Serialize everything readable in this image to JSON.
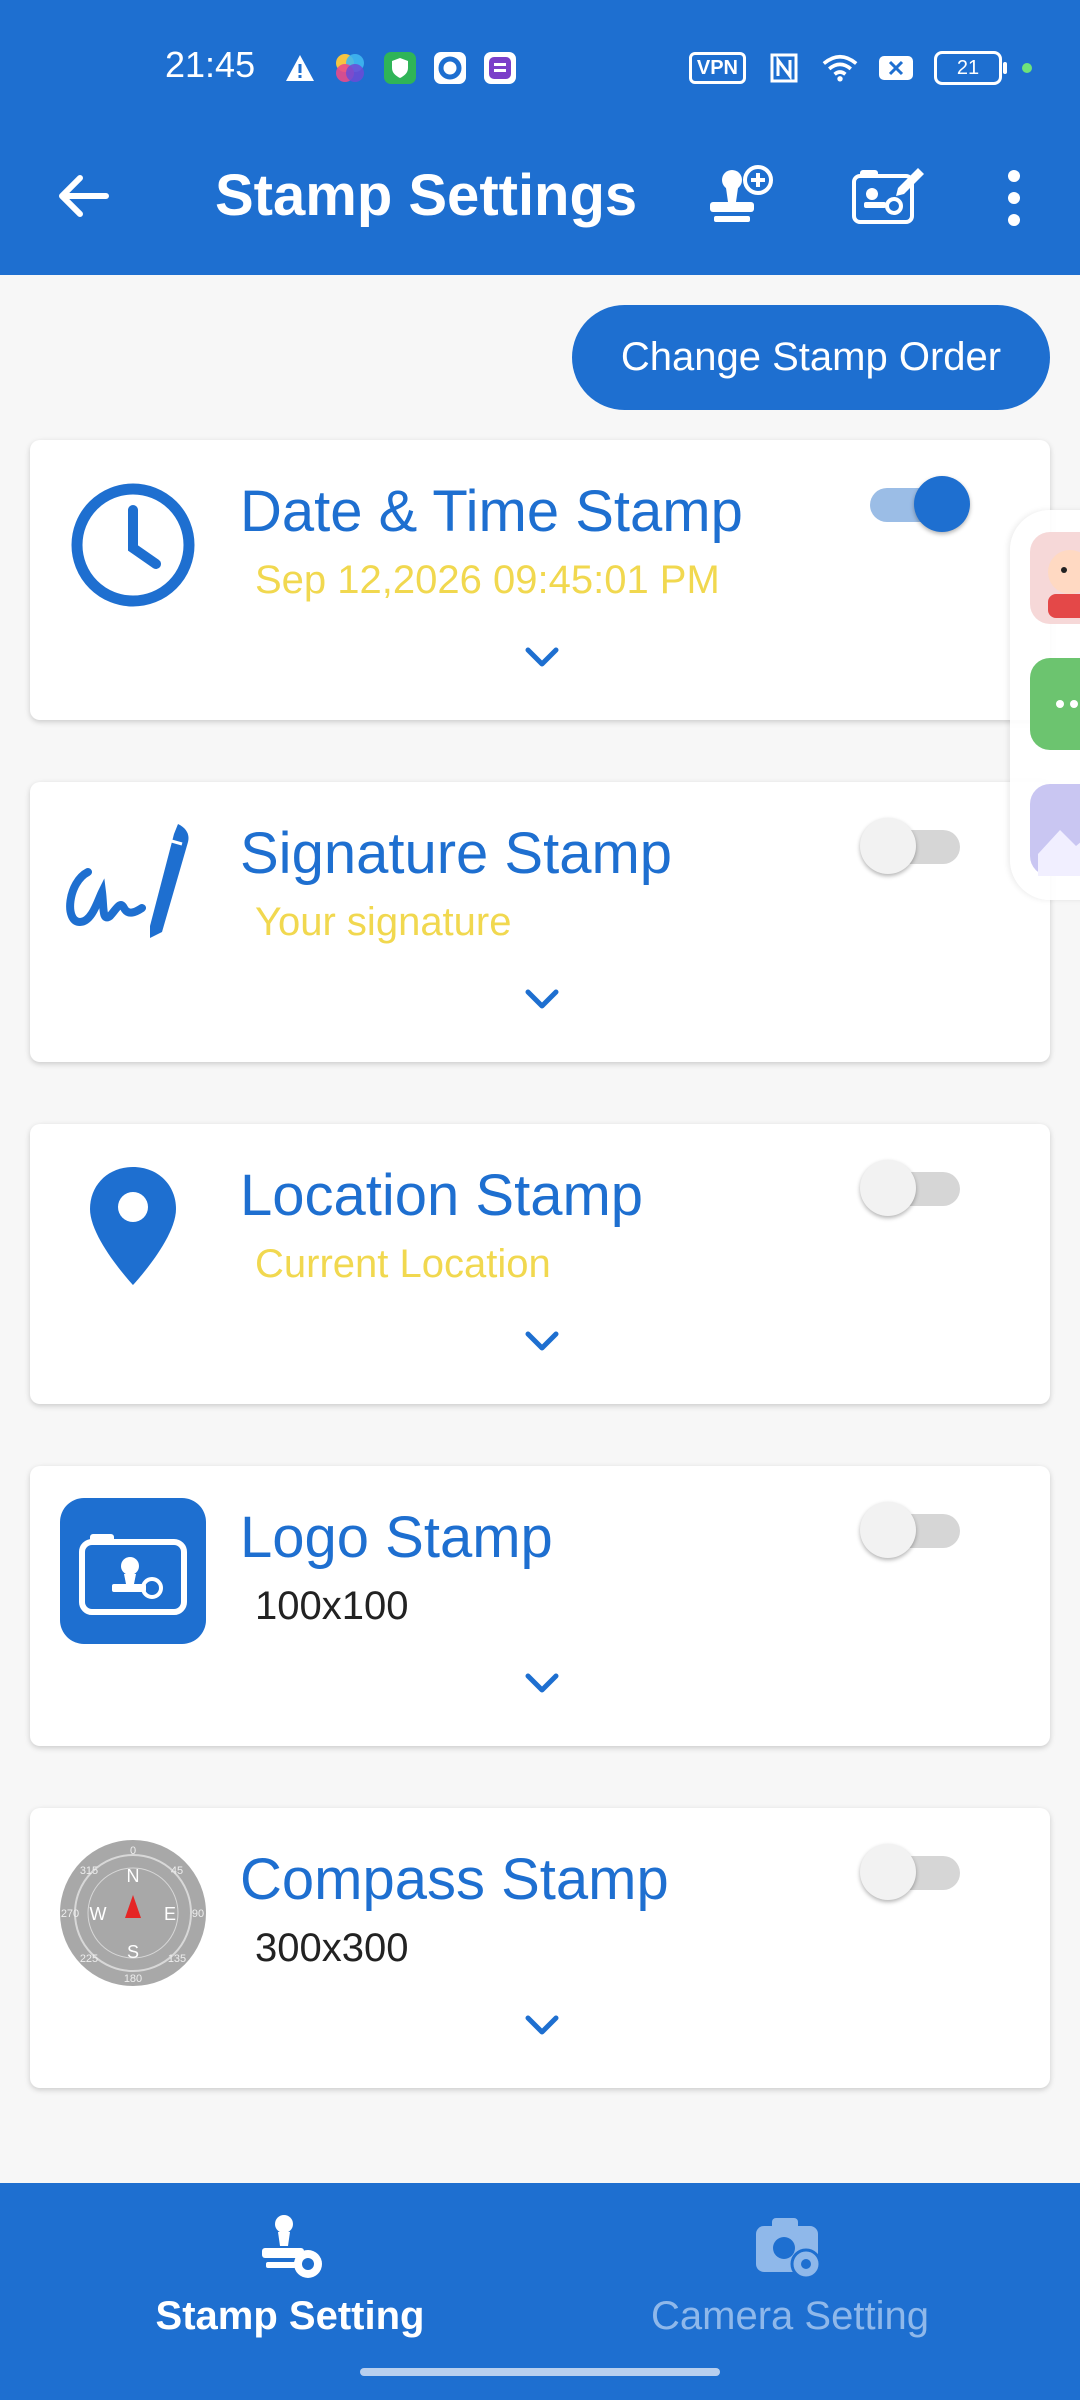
{
  "status_bar": {
    "time": "21:45",
    "left_icons": [
      "warning-icon",
      "app-color-icon",
      "shield-app-icon",
      "circle-app-icon",
      "sticker-app-icon"
    ],
    "vpn": "VPN",
    "battery": "21",
    "right_icons": [
      "nfc-icon",
      "wifi-icon",
      "signal-x-icon"
    ]
  },
  "app_bar": {
    "title": "Stamp Settings",
    "actions": [
      "add-stamp-icon",
      "edit-stamp-icon",
      "more-vert-icon"
    ]
  },
  "change_order_label": "Change Stamp Order",
  "cards": [
    {
      "title": "Date & Time Stamp",
      "subtitle": "Sep 12,2026 09:45:01 PM",
      "subtitle_style": "yellow",
      "enabled": true,
      "icon": "clock-icon"
    },
    {
      "title": "Signature Stamp",
      "subtitle": "Your signature",
      "subtitle_style": "yellow",
      "enabled": false,
      "icon": "signature-pen-icon"
    },
    {
      "title": "Location Stamp",
      "subtitle": "Current Location",
      "subtitle_style": "yellow",
      "enabled": false,
      "icon": "location-pin-icon"
    },
    {
      "title": "Logo Stamp",
      "subtitle": "100x100",
      "subtitle_style": "dark",
      "enabled": false,
      "icon": "logo-camera-icon"
    },
    {
      "title": "Compass Stamp",
      "subtitle": "300x300",
      "subtitle_style": "dark",
      "enabled": false,
      "icon": "compass-icon"
    }
  ],
  "compass_labels": {
    "n": "N",
    "s": "S",
    "e": "E",
    "w": "W",
    "zero": "0",
    "one_eighty": "180",
    "ninety": "90",
    "two_seventy": "270",
    "forty_five": "45",
    "three_fifteen": "315",
    "one_thirty_five": "135",
    "two_twenty_five": "225"
  },
  "bottom_nav": {
    "items": [
      {
        "label": "Stamp Setting",
        "active": true
      },
      {
        "label": "Camera Setting",
        "active": false
      }
    ]
  },
  "colors": {
    "primary": "#1e6fd0",
    "subtitle_yellow": "#f1d84f",
    "background": "#f7f7f7"
  }
}
